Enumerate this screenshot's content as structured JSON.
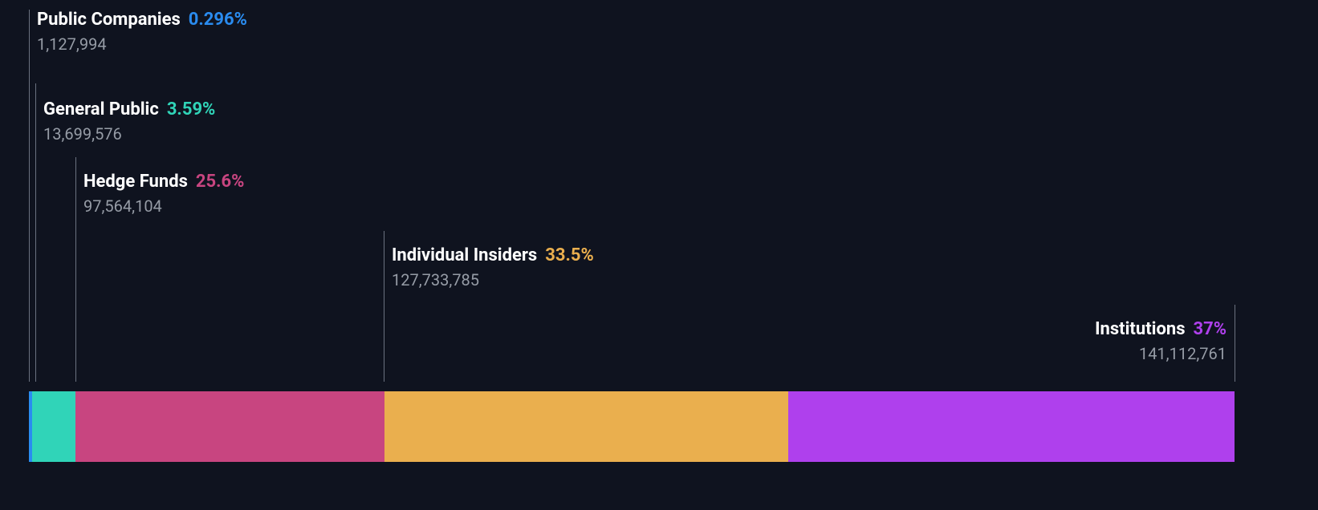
{
  "chart_data": {
    "type": "bar",
    "title": "",
    "series": [
      {
        "name": "Public Companies",
        "percent": 0.296,
        "percent_label": "0.296%",
        "value": 1127994,
        "value_label": "1,127,994",
        "color": "#2a8cf0"
      },
      {
        "name": "General Public",
        "percent": 3.59,
        "percent_label": "3.59%",
        "value": 13699576,
        "value_label": "13,699,576",
        "color": "#30d4b8"
      },
      {
        "name": "Hedge Funds",
        "percent": 25.6,
        "percent_label": "25.6%",
        "value": 97564104,
        "value_label": "97,564,104",
        "color": "#c84580"
      },
      {
        "name": "Individual Insiders",
        "percent": 33.5,
        "percent_label": "33.5%",
        "value": 127733785,
        "value_label": "127,733,785",
        "color": "#eaaf4e"
      },
      {
        "name": "Institutions",
        "percent": 37.0,
        "percent_label": "37%",
        "value": 141112761,
        "value_label": "141,112,761",
        "color": "#af40ed"
      }
    ]
  }
}
